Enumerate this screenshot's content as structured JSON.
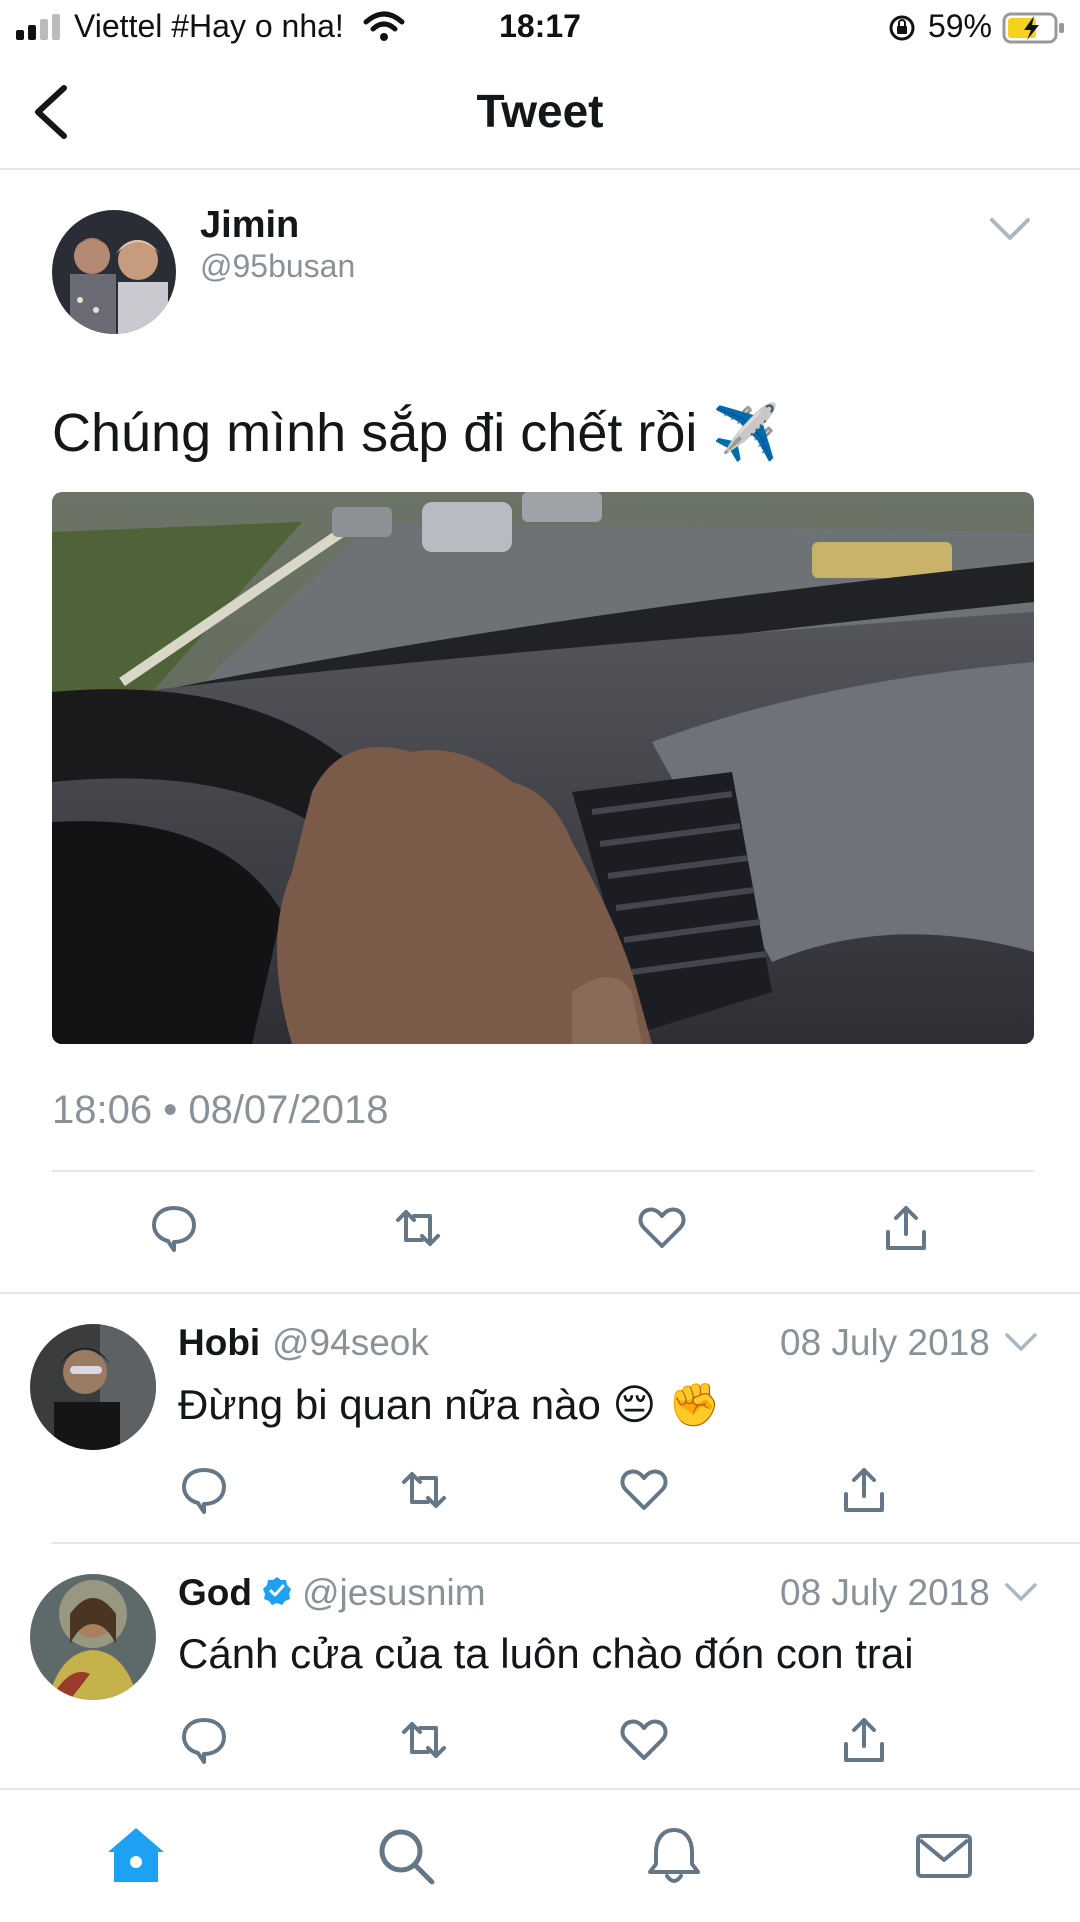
{
  "status_bar": {
    "carrier": "Viettel #Hay o nha!",
    "time": "18:17",
    "battery_percent": "59%"
  },
  "header": {
    "title": "Tweet"
  },
  "tweet": {
    "author_name": "Jimin",
    "author_handle": "@95busan",
    "text": "Chúng mình sắp đi chết rồi ✈️",
    "timestamp": "18:06 • 08/07/2018",
    "image_alt": "car-dashboard-photo"
  },
  "replies": [
    {
      "name": "Hobi",
      "handle": "@94seok",
      "verified": false,
      "date": "08 July 2018",
      "text": "Đừng bi quan nữa nào 😔 ✊"
    },
    {
      "name": "God",
      "handle": "@jesusnim",
      "verified": true,
      "date": "08 July 2018",
      "text": "Cánh cửa của ta luôn chào đón con trai"
    }
  ],
  "tab_bar": {
    "tabs": [
      "home-icon",
      "search-icon",
      "notifications-icon",
      "messages-icon"
    ],
    "active": "home-icon"
  },
  "colors": {
    "accent": "#1da1f2",
    "icon_gray": "#657786",
    "muted_text": "#8a9299",
    "divider": "#e1e8ed"
  }
}
